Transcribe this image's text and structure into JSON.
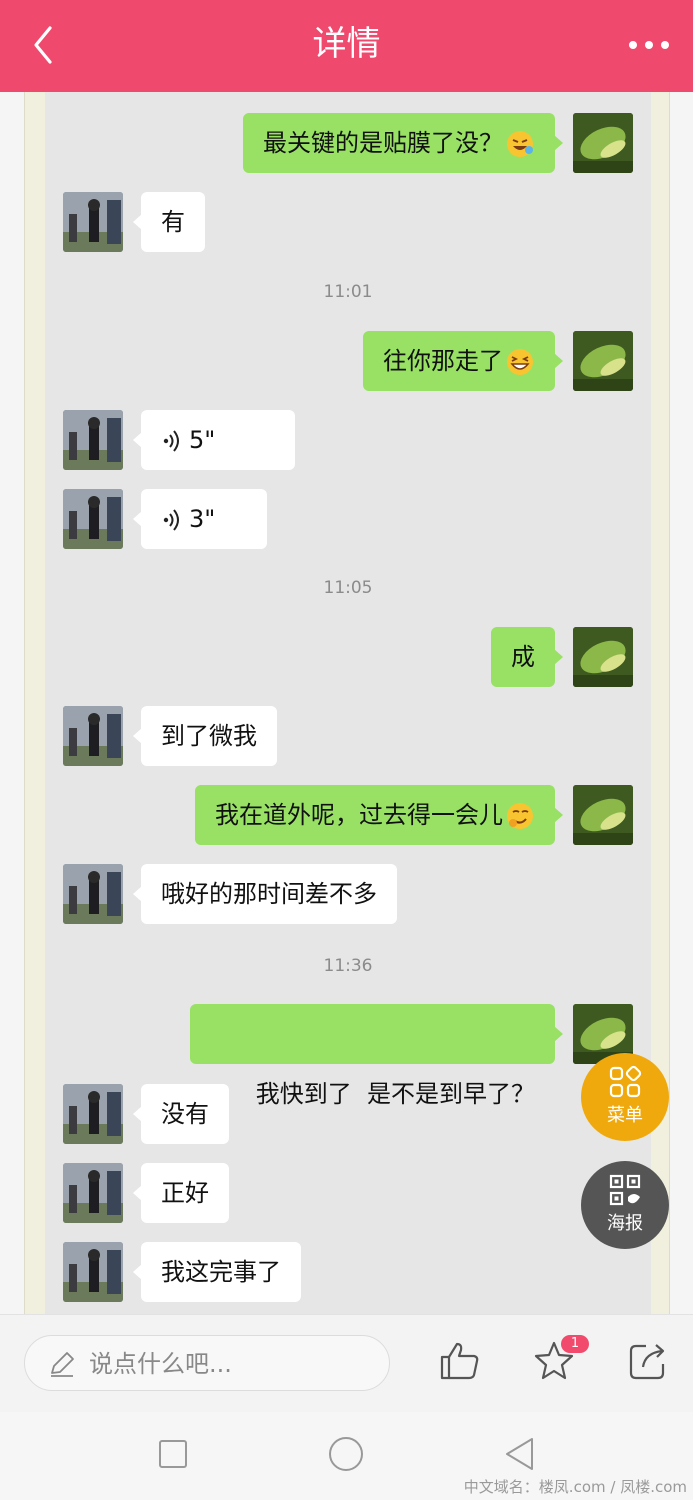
{
  "header": {
    "title": "详情",
    "back_icon": "chevron-left-icon",
    "more_icon": "more-dots-icon",
    "color": "#ef4a6e"
  },
  "chat": {
    "messages": [
      {
        "side": "self",
        "text": "最关键的是贴膜了没？",
        "emoji": "rolling-laugh-emoji"
      },
      {
        "side": "other",
        "text": "有"
      },
      {
        "type": "time",
        "text": "11:01"
      },
      {
        "side": "self",
        "text": "往你那走了",
        "emoji": "grin-emoji"
      },
      {
        "side": "other",
        "type": "voice",
        "text": "5\""
      },
      {
        "side": "other",
        "type": "voice",
        "text": "3\""
      },
      {
        "type": "time",
        "text": "11:05"
      },
      {
        "side": "self",
        "text": "成"
      },
      {
        "side": "other",
        "text": "到了微我"
      },
      {
        "side": "self",
        "text": "我在道外呢，过去得一会儿",
        "emoji": "smirk-emoji"
      },
      {
        "side": "other",
        "text": "哦好的那时间差不多"
      },
      {
        "type": "time",
        "text": "11:36"
      },
      {
        "side": "self",
        "text": "我快到了  是不是到早了？"
      },
      {
        "side": "other",
        "text": "没有"
      },
      {
        "side": "other",
        "text": "正好"
      },
      {
        "side": "other",
        "text": "我这完事了"
      }
    ],
    "bubble_self_color": "#98e165",
    "bubble_other_color": "#ffffff"
  },
  "fab": {
    "menu": {
      "label": "菜单",
      "icon": "grid-menu-icon",
      "color": "#f0a90d"
    },
    "poster": {
      "label": "海报",
      "icon": "qr-code-icon",
      "color": "#555555"
    }
  },
  "bottom_bar": {
    "comment_placeholder": "说点什么吧...",
    "pen_icon": "pen-icon",
    "like_icon": "thumbs-up-icon",
    "favorite_icon": "star-icon",
    "favorite_badge": "1",
    "share_icon": "share-icon"
  },
  "nav_bar": {
    "recent_icon": "square-icon",
    "home_icon": "circle-icon",
    "back_icon": "triangle-back-icon"
  },
  "watermark": "中文域名：楼凤.com / 凤楼.com"
}
